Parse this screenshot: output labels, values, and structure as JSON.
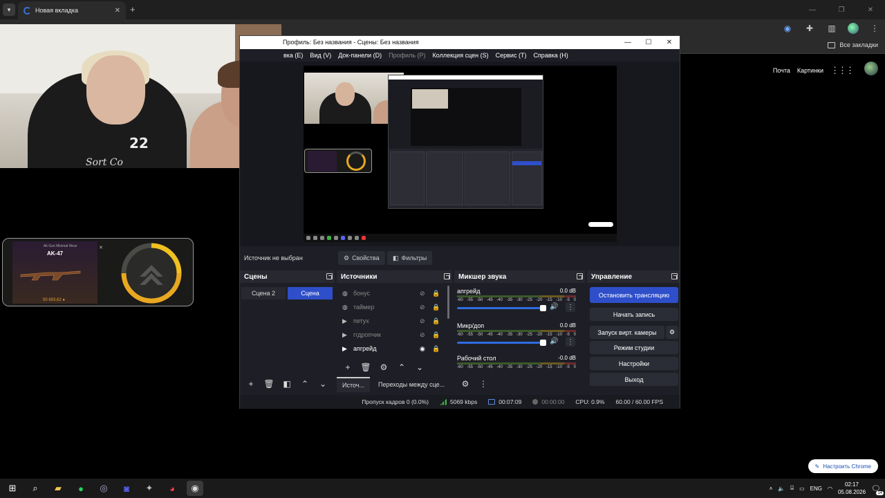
{
  "browser": {
    "tab_title": "Новая вкладка",
    "all_bookmarks": "Все закладки",
    "links": [
      "Почта",
      "Картинки"
    ],
    "customize": "Настроить Chrome"
  },
  "case_widget": {
    "small_caption": "Ak Gun Minimal Wear",
    "weapon": "AK-47",
    "price": "50 693,62 ●"
  },
  "obs": {
    "title": "Профиль: Без названия - Сцены: Без названия",
    "menu": [
      "вка (E)",
      "Вид (V)",
      "Док-панели (D)",
      "Профиль (P)",
      "Коллекция сцен (S)",
      "Сервис (T)",
      "Справка (H)"
    ],
    "no_source": "Источник не выбран",
    "properties_btn": "Свойства",
    "filters_btn": "Фильтры",
    "scenes": {
      "title": "Сцены",
      "items": [
        {
          "label": "Сцена 2",
          "active": false
        },
        {
          "label": "Сцена",
          "active": true
        }
      ]
    },
    "sources": {
      "title": "Источники",
      "items": [
        {
          "label": "бонус",
          "type": "browser",
          "visible": false
        },
        {
          "label": "таймер",
          "type": "browser",
          "visible": false
        },
        {
          "label": "петух",
          "type": "media",
          "visible": false
        },
        {
          "label": "ггдропчик",
          "type": "media",
          "visible": false
        },
        {
          "label": "апгрейд",
          "type": "media",
          "visible": true
        }
      ]
    },
    "mixer": {
      "title": "Микшер звука",
      "ticks": [
        "-60",
        "-55",
        "-50",
        "-45",
        "-40",
        "-35",
        "-30",
        "-25",
        "-20",
        "-15",
        "-10",
        "-5",
        "0"
      ],
      "channels": [
        {
          "name": "апгрейд",
          "db": "0.0 dB",
          "volume": 1.0
        },
        {
          "name": "Микр/доп",
          "db": "0.0 dB",
          "volume": 1.0
        },
        {
          "name": "Рабочий стол",
          "db": "-0.0 dB",
          "volume": 1.0
        }
      ]
    },
    "controls": {
      "title": "Управление",
      "stop_stream": "Остановить трансляцию",
      "start_record": "Начать запись",
      "virtual_cam": "Запуск вирт. камеры",
      "studio_mode": "Режим студии",
      "settings": "Настройки",
      "exit": "Выход"
    },
    "bottom_tabs": [
      "Источ...",
      "Переходы между сце..."
    ],
    "status": {
      "dropped": "Пропуск кадров 0 (0.0%)",
      "bitrate": "5069 kbps",
      "stream_time": "00:07:09",
      "rec_time": "00:00:00",
      "cpu": "CPU: 0.9%",
      "fps": "60.00 / 60.00 FPS"
    }
  },
  "webcam": {
    "shirt_number": "22",
    "shirt_text": "Sort Co"
  },
  "taskbar": {
    "lang": "ENG",
    "time": "02:17",
    "date": "05.08.2026",
    "notifications": "14"
  },
  "colors": {
    "accent": "#2e4fc9",
    "obs_bg": "#1e1f26",
    "meter_green": "#3cb043"
  }
}
